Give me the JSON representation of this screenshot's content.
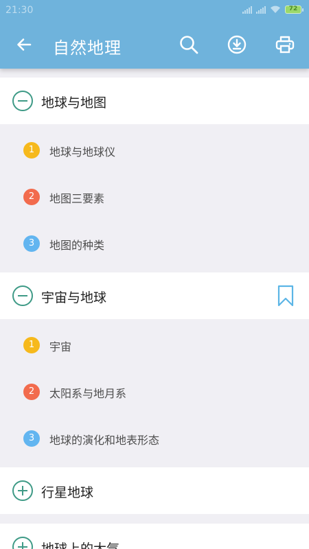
{
  "status_bar": {
    "time": "21:30",
    "battery": "72"
  },
  "toolbar": {
    "title": "自然地理"
  },
  "icons": {
    "back": "arrow-left-icon",
    "search": "search-icon",
    "download": "download-icon",
    "print": "printer-icon",
    "bookmark": "bookmark-icon"
  },
  "colors": {
    "appbar": "#6fb3dc",
    "toggle": "#3e9a86",
    "badge_1": "#f6b91c",
    "badge_2": "#f26b4d",
    "badge_3": "#62b5f0"
  },
  "sections": [
    {
      "title": "地球与地图",
      "expanded": true,
      "items": [
        {
          "num": "1",
          "label": "地球与地球仪"
        },
        {
          "num": "2",
          "label": "地图三要素"
        },
        {
          "num": "3",
          "label": "地图的种类"
        }
      ]
    },
    {
      "title": "宇宙与地球",
      "expanded": true,
      "bookmarked": true,
      "items": [
        {
          "num": "1",
          "label": "宇宙"
        },
        {
          "num": "2",
          "label": "太阳系与地月系"
        },
        {
          "num": "3",
          "label": "地球的演化和地表形态"
        }
      ]
    },
    {
      "title": "行星地球",
      "expanded": false
    },
    {
      "title": "地球上的大气",
      "expanded": false
    }
  ]
}
